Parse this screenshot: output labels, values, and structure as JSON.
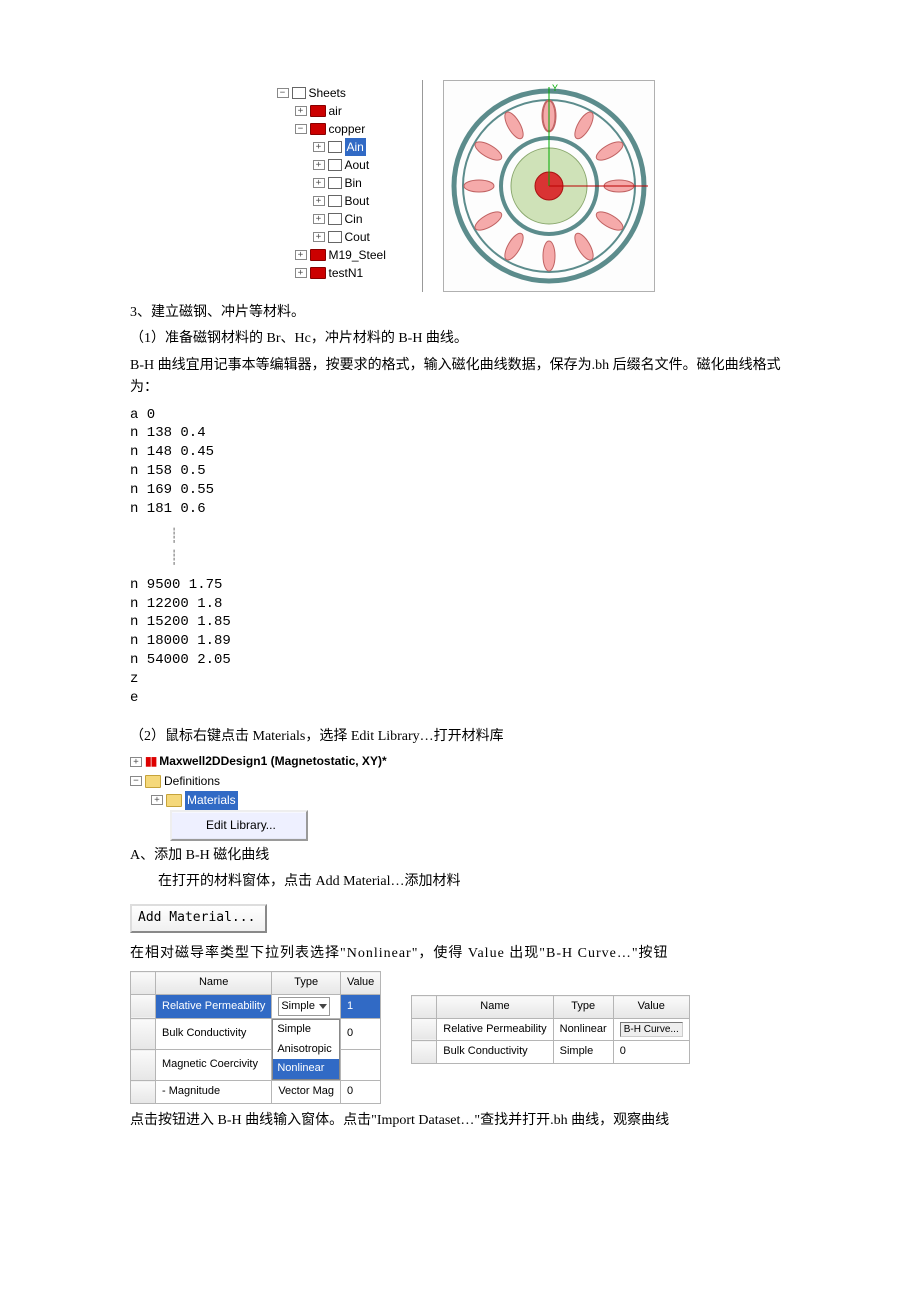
{
  "tree": {
    "root": "Sheets",
    "items": [
      {
        "label": "air"
      },
      {
        "label": "copper"
      },
      {
        "label": "Ain",
        "selected": true
      },
      {
        "label": "Aout"
      },
      {
        "label": "Bin"
      },
      {
        "label": "Bout"
      },
      {
        "label": "Cin"
      },
      {
        "label": "Cout"
      },
      {
        "label": "M19_Steel"
      },
      {
        "label": "testN1"
      }
    ]
  },
  "text": {
    "p1": "3、建立磁钢、冲片等材料。",
    "p2": "（1）准备磁钢材料的 Br、Hc，冲片材料的 B-H 曲线。",
    "p3": "B-H 曲线宜用记事本等编辑器，按要求的格式，输入磁化曲线数据，保存为.bh 后缀名文件。磁化曲线格式为：",
    "bh_a": "a 0\nn 138 0.4\nn 148 0.45\nn 158 0.5\nn 169 0.55\nn 181 0.6",
    "bh_b": "n 9500 1.75\nn 12200 1.8\nn 15200 1.85\nn 18000 1.89\nn 54000 2.05\nz\ne",
    "p4": "（2）鼠标右键点击 Materials，选择 Edit Library…打开材料库",
    "design_label": "Maxwell2DDesign1 (Magnetostatic, XY)*",
    "definitions": "Definitions",
    "materials_sel": "Materials",
    "ctx_item": "Edit Library...",
    "pA": "A、添加 B-H 磁化曲线",
    "pA2": "在打开的材料窗体，点击 Add Material…添加材料",
    "add_btn": "Add Material...",
    "p5": "在相对磁导率类型下拉列表选择\"Nonlinear\"，使得 Value 出现\"B-H Curve…\"按钮",
    "p6": "点击按钮进入 B-H 曲线输入窗体。点击\"Import Dataset…\"查找并打开.bh 曲线，观察曲线"
  },
  "table1": {
    "h_name": "Name",
    "h_type": "Type",
    "h_value": "Value",
    "r1_name": "Relative Permeability",
    "r1_type": "Simple",
    "r1_val": "1",
    "r2_name": "Bulk Conductivity",
    "r2_val": "0",
    "r3_name": "Magnetic Coercivity",
    "dd_simple": "Simple",
    "dd_aniso": "Anisotropic",
    "dd_nonlin": "Nonlinear",
    "r4_name": "- Magnitude",
    "r4_type": "Vector Mag",
    "r4_val": "0"
  },
  "table2": {
    "h_name": "Name",
    "h_type": "Type",
    "h_value": "Value",
    "r1_name": "Relative Permeability",
    "r1_type": "Nonlinear",
    "r1_val": "B-H Curve...",
    "r2_name": "Bulk Conductivity",
    "r2_type": "Simple",
    "r2_val": "0"
  }
}
